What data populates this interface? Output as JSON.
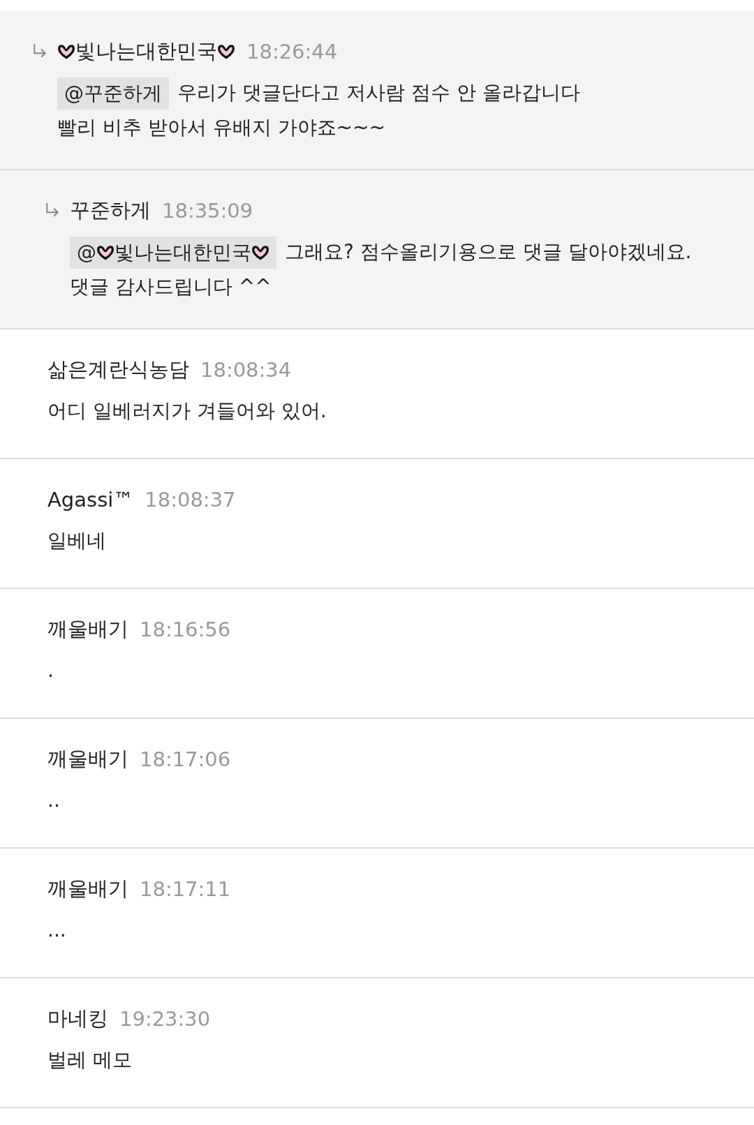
{
  "comments": [
    {
      "kind": "reply",
      "author": "빛나는대한민국",
      "decorated": true,
      "time": "18:26:44",
      "mention": {
        "at": "@",
        "name": "꾸준하게"
      },
      "text": "우리가 댓글단다고 저사람 점수 안 올라갑니다\n빨리 비추 받아서 유배지 가야죠~~~",
      "children": [
        {
          "kind": "reply",
          "author": "꾸준하게",
          "time": "18:35:09",
          "mention": {
            "at": "@",
            "name": "빛나는대한민국",
            "decorated": true
          },
          "text": "그래요? 점수올리기용으로 댓글 달아야겠네요. 댓글 감사드립니다 ^^"
        }
      ]
    },
    {
      "kind": "comment",
      "author": "삶은계란식농담",
      "time": "18:08:34",
      "text": "어디 일베러지가 겨들어와 있어."
    },
    {
      "kind": "comment",
      "author": "Agassi™",
      "time": "18:08:37",
      "text": "일베네"
    },
    {
      "kind": "comment",
      "author": "깨울배기",
      "time": "18:16:56",
      "text": "."
    },
    {
      "kind": "comment",
      "author": "깨울배기",
      "time": "18:17:06",
      "text": ".."
    },
    {
      "kind": "comment",
      "author": "깨울배기",
      "time": "18:17:11",
      "text": "..."
    },
    {
      "kind": "comment",
      "author": "마네킹",
      "time": "19:23:30",
      "text": "벌레 메모"
    }
  ]
}
